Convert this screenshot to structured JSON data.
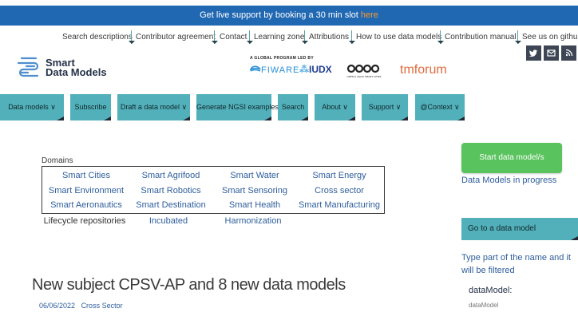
{
  "banner": {
    "text": "Get live support by booking a 30 min slot ",
    "link": "here"
  },
  "top_links": [
    "Search descriptions",
    "Contributor agreement",
    "Contact",
    "Learning zone",
    "Attributions",
    "How to use data models",
    "Contribution manual",
    "See us on github"
  ],
  "social_icons": [
    "twitter-icon",
    "mail-icon",
    "rss-icon"
  ],
  "logo": {
    "line1": "Smart",
    "line2": "Data Models"
  },
  "program": {
    "label": "A GLOBAL PROGRAM LED BY",
    "partners": [
      "FIWARE",
      "IUDX",
      "OPEN & AGILE SMART CITIES",
      "tmforum"
    ]
  },
  "nav": [
    "Data models ∨",
    "Subscribe",
    "Draft a data model ∨",
    "Generate NGSI examples ∨",
    "Search",
    "About ∨",
    "Support ∨",
    "@Context ∨"
  ],
  "domains": {
    "title": "Domains",
    "rows": [
      [
        "Smart Cities",
        "Smart Agrifood",
        "Smart Water",
        "Smart Energy"
      ],
      [
        "Smart Environment",
        "Smart Robotics",
        "Smart Sensoring",
        "Cross sector"
      ],
      [
        "Smart Aeronautics",
        "Smart Destination",
        "Smart Health",
        "Smart Manufacturing"
      ]
    ],
    "extra": [
      "Lifecycle repositories",
      "Incubated",
      "Harmonization"
    ]
  },
  "post": {
    "title": "New subject CPSV-AP and 8 new data models",
    "date": "06/06/2022",
    "category": "Cross Sector"
  },
  "sidebar": {
    "start_button": "Start data model/s",
    "progress_link": "Data Models in progress",
    "goto_title": "Go to a data model",
    "hint": "Type part of the name and it will be filtered",
    "field_label": "dataModel:",
    "field_placeholder": "dataModel"
  },
  "colors": {
    "banner": "#2168b3",
    "nav": "#52b0ba",
    "start_button": "#59c35d",
    "link": "#2e5e9b",
    "banner_link": "#f89a2c"
  }
}
